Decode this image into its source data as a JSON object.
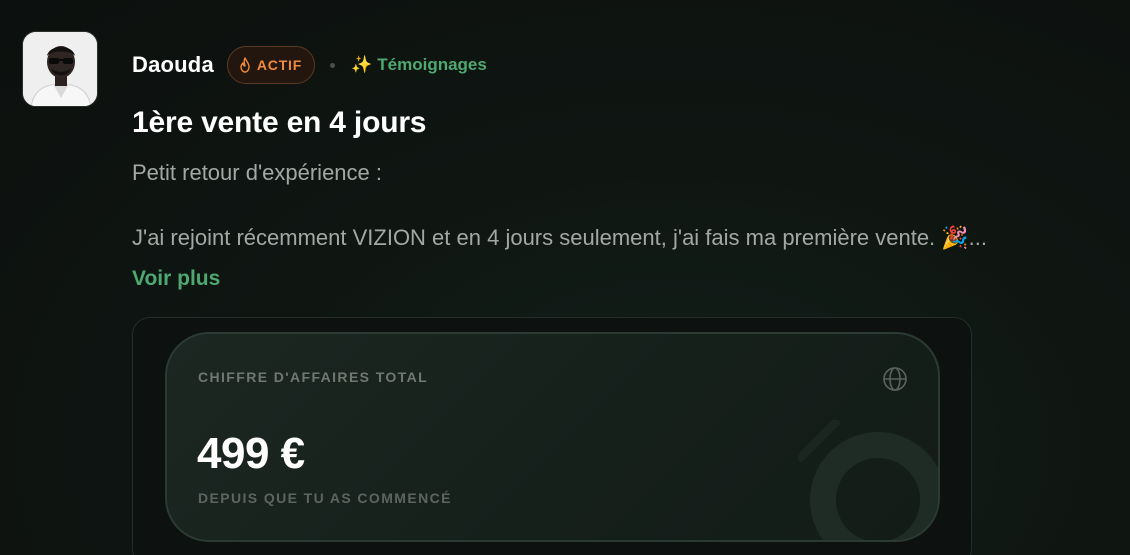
{
  "post": {
    "author": "Daouda",
    "badge": {
      "label": "ACTIF",
      "icon": "flame-icon",
      "color": "#f08a3c"
    },
    "category": {
      "emoji": "✨",
      "label": "Témoignages",
      "color": "#4fa871"
    },
    "title": "1ère vente en 4 jours",
    "excerpt_line1": "Petit retour d'expérience :",
    "excerpt_line2": "J'ai rejoint récemment VIZION et en 4 jours seulement, j'ai fais ma première vente. 🎉...",
    "see_more": "Voir plus"
  },
  "media_card": {
    "label": "CHIFFRE D'AFFAIRES TOTAL",
    "amount": "499 €",
    "sub_label": "DEPUIS QUE TU AS COMMENCÉ",
    "icon": "globe-icon"
  },
  "colors": {
    "background": "#0e1210",
    "accent_green": "#4fa871",
    "badge_orange": "#f08a3c"
  }
}
